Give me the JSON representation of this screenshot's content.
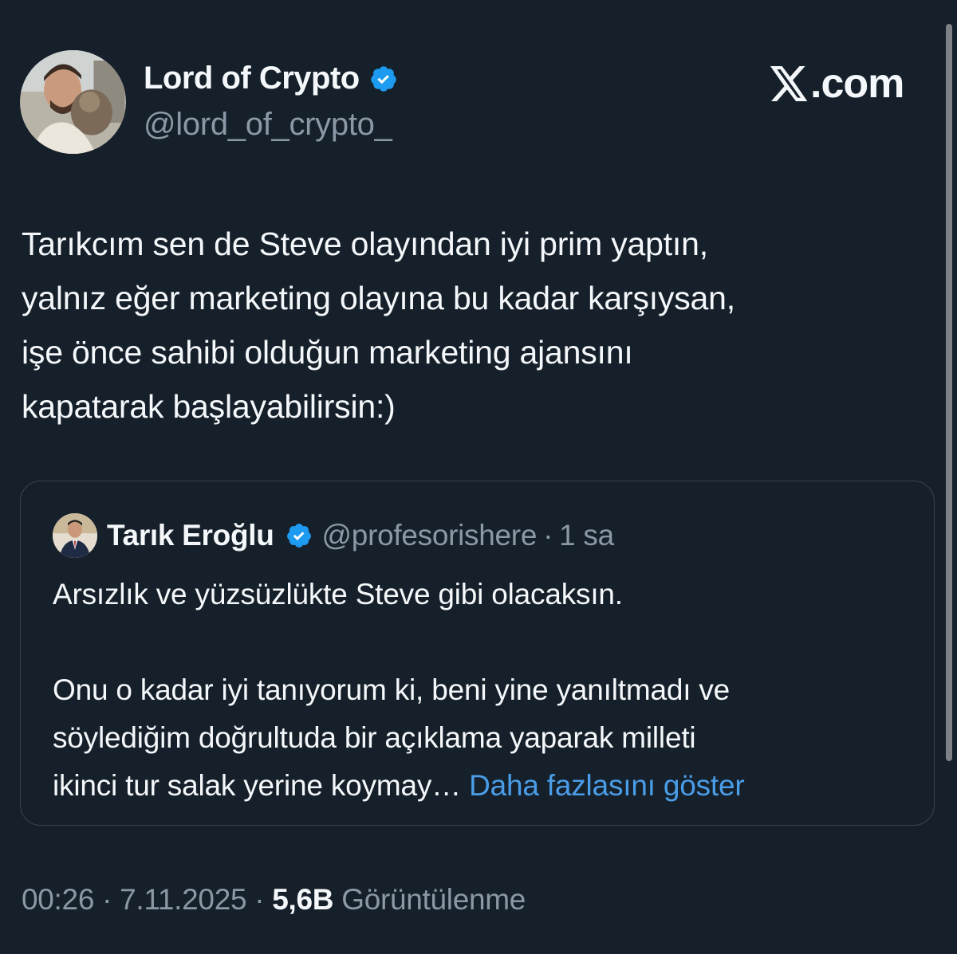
{
  "author": {
    "display_name": "Lord of Crypto",
    "handle": "@lord_of_crypto_",
    "verified": true,
    "avatar_icon": "profile-photo-man-with-cat"
  },
  "brand": {
    "logo_icon": "x-logo-icon",
    "text": ".com"
  },
  "tweet": {
    "text": "Tarıkcım sen de Steve olayından iyi prim yaptın,\nyalnız eğer marketing olayına bu kadar karşıysan,\nişe önce sahibi olduğun marketing ajansını\nkapatarak başlayabilirsin:)"
  },
  "quoted_tweet": {
    "display_name": "Tarık Eroğlu",
    "handle": "@profesorishere",
    "separator": "·",
    "time": "1 sa",
    "verified": true,
    "avatar_icon": "profile-photo-man-in-suit",
    "paragraph_1": "Arsızlık ve yüzsüzlükte Steve gibi olacaksın.",
    "paragraph_2": "Onu o kadar iyi tanıyorum ki, beni yine yanıltmadı ve\nsöylediğim doğrultuda bir açıklama yaparak milleti\nikinci tur salak yerine koymay…",
    "more_link": "Daha fazlasını göster"
  },
  "meta": {
    "time": "00:26",
    "separator": "·",
    "date": "7.11.2025",
    "views_count": "5,6B",
    "views_label": "Görüntülenme"
  },
  "colors": {
    "background": "#16202b",
    "text_primary": "#f5f8fa",
    "text_secondary": "#8b98a5",
    "link": "#4a9de8",
    "verified_badge": "#1d9bf0",
    "card_border": "#38444d"
  }
}
